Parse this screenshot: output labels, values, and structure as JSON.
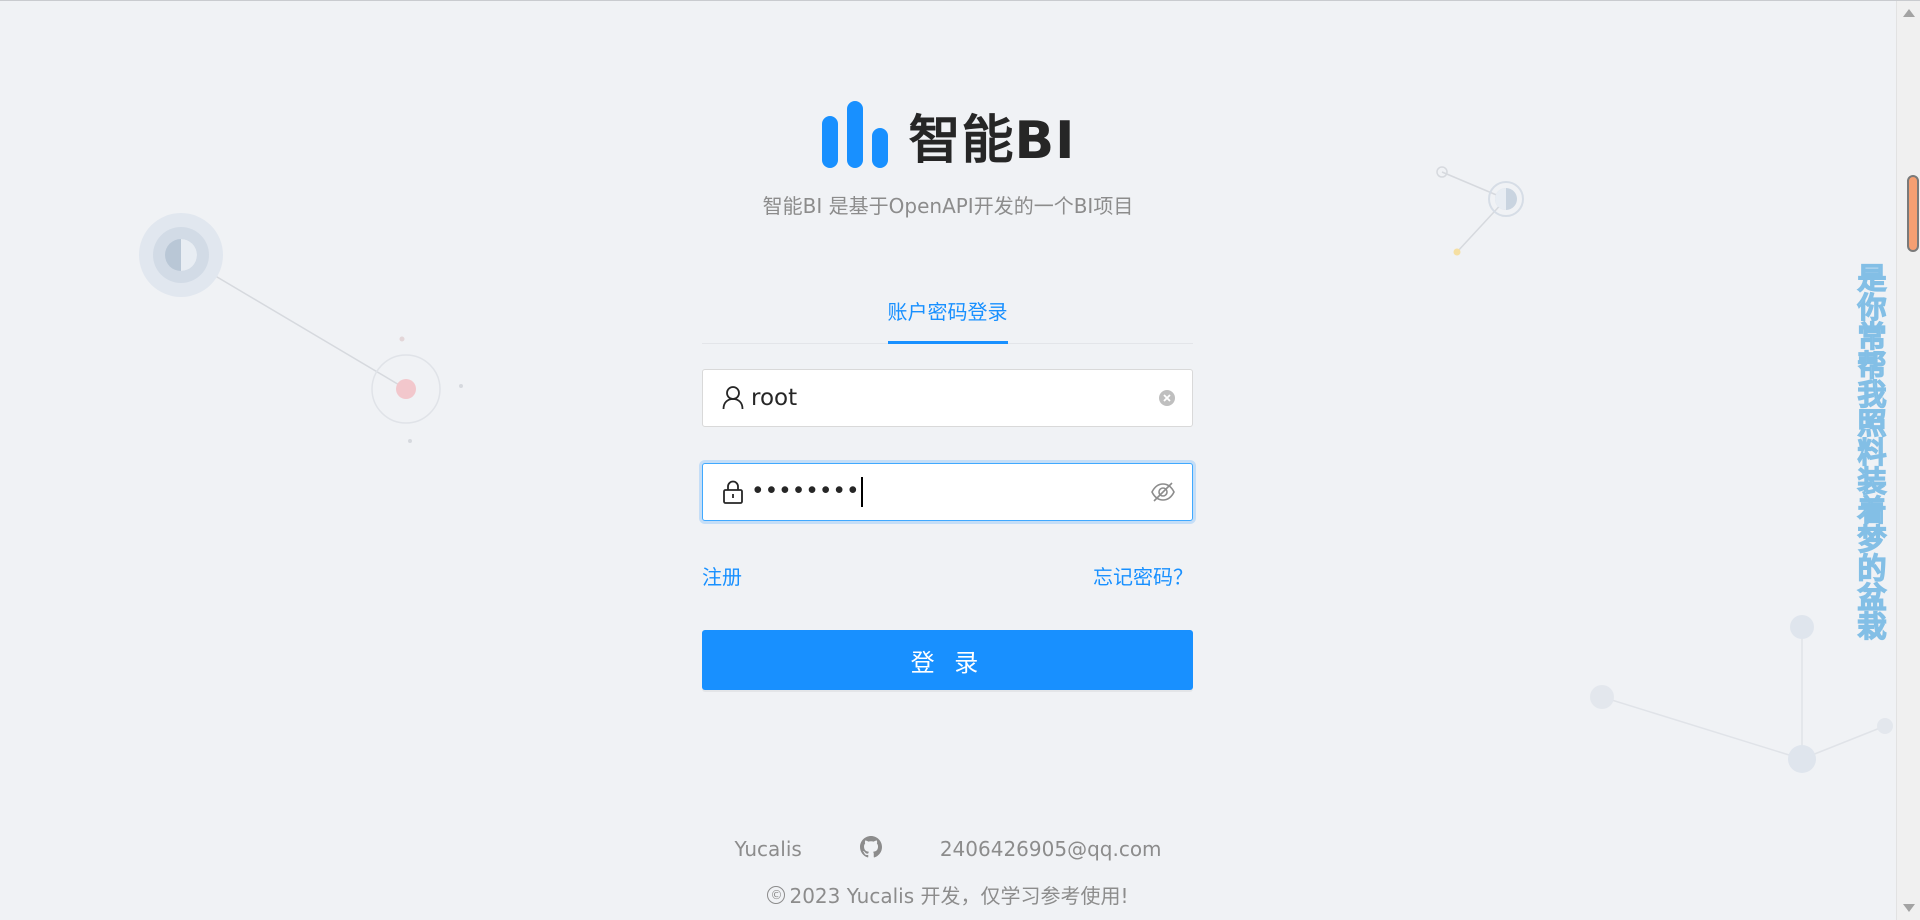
{
  "header": {
    "title": "智能BI",
    "description": "智能BI 是基于OpenAPI开发的一个BI项目",
    "logo_icon": "bar-chart-logo-icon",
    "brand_color": "#1890ff"
  },
  "login": {
    "tab_label": "账户密码登录",
    "username_value": "root",
    "password_value": "••••••••",
    "register_label": "注册",
    "forgot_label": "忘记密码？",
    "submit_label": "登 录"
  },
  "footer": {
    "author": "Yucalis",
    "github_icon": "github-icon",
    "email": "2406426905@qq.com",
    "copyright_symbol": "©",
    "copyright_text": "2023 Yucalis 开发，仅学习参考使用!"
  },
  "side_text": "是你常帮我照料装着梦的盆栽"
}
